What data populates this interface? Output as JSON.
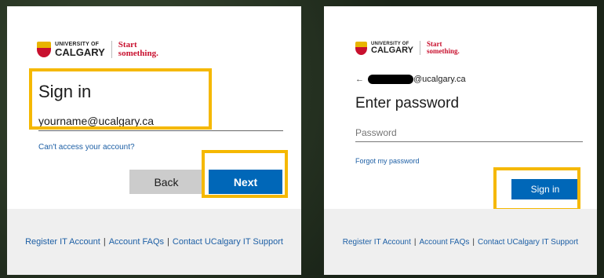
{
  "left": {
    "logo": {
      "line1": "UNIVERSITY OF",
      "line2": "CALGARY",
      "tag1": "Start",
      "tag2": "something."
    },
    "heading": "Sign in",
    "email_value": "yourname@ucalgary.ca",
    "cant_access_link": "Can't access your account?",
    "back_label": "Back",
    "next_label": "Next"
  },
  "right": {
    "logo": {
      "line1": "UNIVERSITY OF",
      "line2": "CALGARY",
      "tag1": "Start",
      "tag2": "something."
    },
    "back_arrow": "←",
    "email_suffix": "@ucalgary.ca",
    "heading": "Enter password",
    "password_placeholder": "Password",
    "forgot_link": "Forgot my password",
    "signin_label": "Sign in"
  },
  "footer": {
    "register": "Register IT Account",
    "faqs": "Account FAQs",
    "support": "Contact UCalgary IT Support",
    "separator": "|"
  },
  "colors": {
    "highlight": "#f5b800",
    "primary": "#0067b8",
    "link": "#1d5fa5",
    "brand_red": "#c8102e"
  }
}
